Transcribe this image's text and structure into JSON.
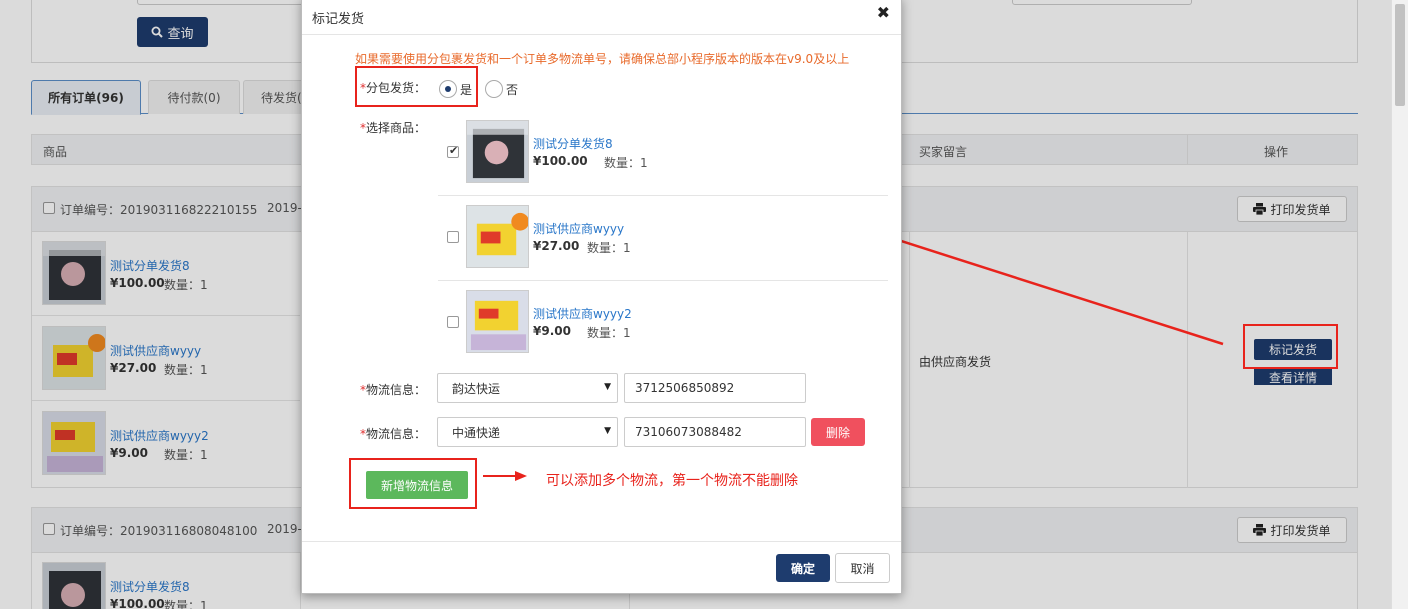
{
  "toolbar": {
    "query_label": "查询"
  },
  "tabs": [
    {
      "label": "所有订单(96)"
    },
    {
      "label": "待付款(0)"
    },
    {
      "label": "待发货("
    }
  ],
  "table_head": {
    "product": "商品",
    "remark": "买家留言",
    "action": "操作"
  },
  "orders": [
    {
      "order_no": "订单编号：201903116822210155",
      "date": "2019-",
      "print_label": "打印发货单",
      "remark": "由供应商发货",
      "items": [
        {
          "name": "测试分单发货8",
          "price": "¥100.00",
          "qty": "数量：1"
        },
        {
          "name": "测试供应商wyyy",
          "price": "¥27.00",
          "qty": "数量：1"
        },
        {
          "name": "测试供应商wyyy2",
          "price": "¥9.00",
          "qty": "数量：1"
        }
      ],
      "mark_ship_label": "标记发货",
      "view_detail_label": "查看详情"
    },
    {
      "order_no": "订单编号：201903116808048100",
      "date": "2019-",
      "print_label": "打印发货单",
      "items": [
        {
          "name": "测试分单发货8",
          "price": "¥100.00",
          "qty": "数量：1"
        }
      ]
    }
  ],
  "modal": {
    "title": "标记发货",
    "close": "✖",
    "notice": "如果需要使用分包裹发货和一个订单多物流单号，请确保总部小程序版本的版本在v9.0及以上",
    "split_label": "分包发货：",
    "required_mark": "*",
    "split_yes": "是",
    "split_no": "否",
    "split_selected": "yes",
    "select_label": "选择商品：",
    "items": [
      {
        "name": "测试分单发货8",
        "price": "¥100.00",
        "qty": "数量：1",
        "checked": true
      },
      {
        "name": "测试供应商wyyy",
        "price": "¥27.00",
        "qty": "数量：1",
        "checked": false
      },
      {
        "name": "测试供应商wyyy2",
        "price": "¥9.00",
        "qty": "数量：1",
        "checked": false
      }
    ],
    "logistics": [
      {
        "label": "物流信息：",
        "carrier": "韵达快运",
        "tracking": "3712506850892"
      },
      {
        "label": "物流信息：",
        "carrier": "中通快递",
        "tracking": "73106073088482",
        "delete_label": "删除"
      }
    ],
    "add_label": "新增物流信息",
    "ok_label": "确定",
    "cancel_label": "取消"
  },
  "annotation": {
    "text": "可以添加多个物流，第一个物流不能删除",
    "color": "#e8231c"
  },
  "colors": {
    "primary": "#1e3c6e",
    "link": "#2a77c9",
    "notice": "#e86a2b",
    "danger": "#f0505e",
    "success": "#5cb85c"
  }
}
